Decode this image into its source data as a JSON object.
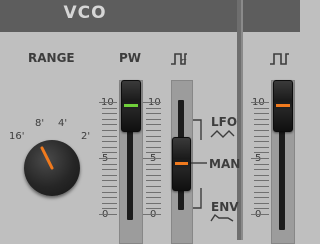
{
  "module": {
    "title": "VCO"
  },
  "range": {
    "label": "RANGE",
    "positions": [
      "16'",
      "8'",
      "4'",
      "2'"
    ]
  },
  "pw": {
    "label": "PW",
    "scale_left": [
      "10",
      "5",
      "0"
    ],
    "scale_right": [
      "10",
      "5",
      "0"
    ]
  },
  "pwm_source": {
    "options": [
      "LFO",
      "MAN",
      "ENV"
    ],
    "selected": "MAN"
  },
  "second_slider": {
    "scale": [
      "10",
      "5",
      "0"
    ]
  },
  "icons": {
    "pulse_wave": "pulse-wave-icon",
    "lfo_wave": "triangle-wave-icon",
    "env_wave": "envelope-icon"
  },
  "colors": {
    "pw_indicator": "#6fcf3a",
    "switch_indicator": "#f07a1e",
    "slider2_indicator": "#f07a1e",
    "knob_pointer": "#f07a1e"
  }
}
